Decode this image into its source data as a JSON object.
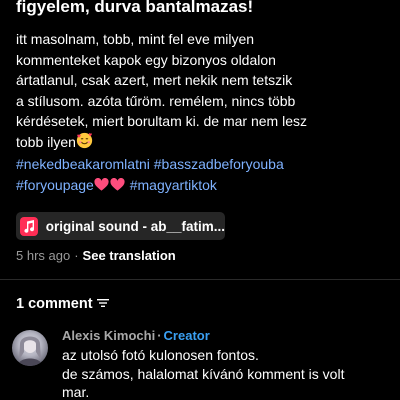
{
  "post": {
    "title": "figyelem, durva bantalmazas!",
    "caption_lines": [
      "itt masolnam, tobb, mint fel eve milyen",
      "kommenteket kapok egy bizonyos oldalon",
      "ártatlanul, csak azert, mert nekik nem tetszik",
      "a stílusom. azóta tűröm. remélem, nincs több",
      "kérdésetek, miert borultam ki. de mar nem lesz",
      "tobb ilyen"
    ],
    "hashtags_line1": "#nekedbeakaromlatni #basszadbeforyouba",
    "hashtag_foryoupage": "#foryoupage",
    "hashtag_magyartiktok": "#magyartiktok",
    "emoji_after_caption": "smiling-face-with-hearts-icon"
  },
  "sound": {
    "label": "original sound - ab__fatim...",
    "icon": "music-note-icon",
    "accent_color": "#ff2d55"
  },
  "meta": {
    "time": "5 hrs ago",
    "separator": "·",
    "translate": "See translation"
  },
  "comments": {
    "header": "1 comment",
    "sort_icon": "sort-icon",
    "items": [
      {
        "author": "Alexis Kimochi",
        "separator": "·",
        "badge": "Creator",
        "text_lines": [
          "az utolsó fotó kulonosen fontos.",
          "de számos, halalomat kívánó komment is volt",
          "mar."
        ]
      }
    ]
  },
  "colors": {
    "background": "#000000",
    "hashtag": "#7fb2ff",
    "creator": "#3aa0f3",
    "muted": "#9a9a9a"
  }
}
